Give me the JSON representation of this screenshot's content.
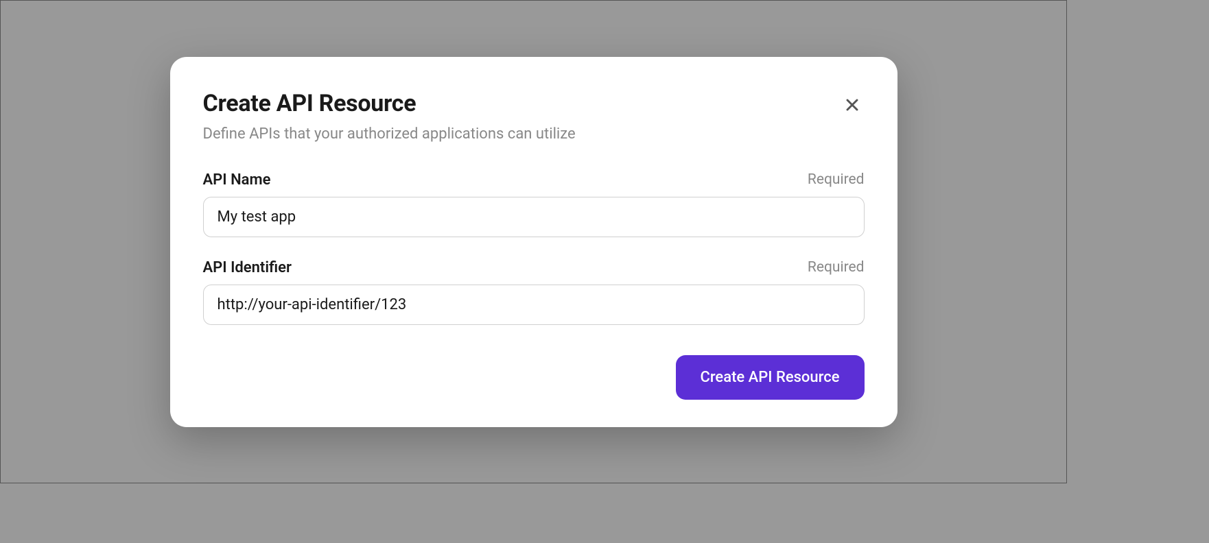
{
  "modal": {
    "title": "Create API Resource",
    "subtitle": "Define APIs that your authorized applications can utilize",
    "fields": {
      "api_name": {
        "label": "API Name",
        "required_text": "Required",
        "value": "My test app"
      },
      "api_identifier": {
        "label": "API Identifier",
        "required_text": "Required",
        "value": "http://your-api-identifier/123"
      }
    },
    "submit_label": "Create API Resource"
  }
}
